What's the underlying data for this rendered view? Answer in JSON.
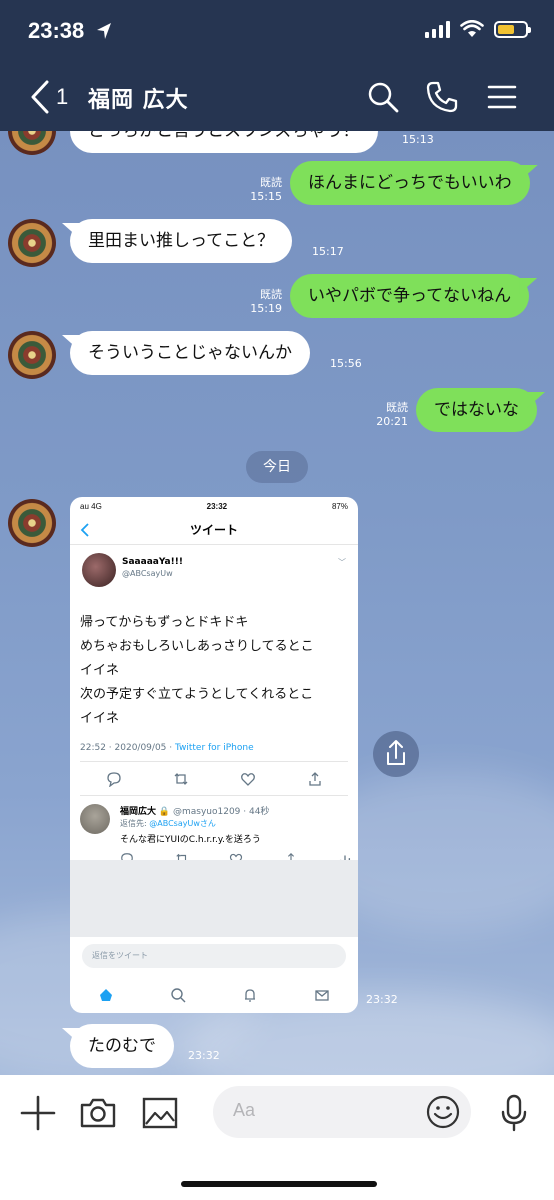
{
  "status_bar": {
    "time": "23:38"
  },
  "header": {
    "back_count": "1",
    "title": "福岡 広大"
  },
  "messages": [
    {
      "side": "left",
      "text": "どっちかと言うとスワンズちゃう？",
      "time": "15:13"
    },
    {
      "side": "right",
      "text": "ほんまにどっちでもいいわ",
      "read": "既読",
      "time": "15:15"
    },
    {
      "side": "left",
      "text": "里田まい推しってこと？",
      "time": "15:17"
    },
    {
      "side": "right",
      "text": "いやパボで争ってないねん",
      "read": "既読",
      "time": "15:19"
    },
    {
      "side": "left",
      "text": "そういうことじゃないんか",
      "time": "15:56"
    },
    {
      "side": "right",
      "text": "ではないな",
      "read": "既読",
      "time": "20:21"
    }
  ],
  "date_separator": "今日",
  "shared_image": {
    "time": "23:32",
    "status": {
      "carrier": "au  4G",
      "time": "23:32",
      "battery": "87%"
    },
    "header_title": "ツイート",
    "tweet": {
      "name": "SaaaaaYa!!!",
      "handle": "@ABCsayUw",
      "lines": [
        "帰ってからもずっとドキドキ",
        "めちゃおもしろいしあっさりしてるとこ",
        "イイネ",
        "次の予定すぐ立てようとしてくれるとこ",
        "イイネ"
      ],
      "timestamp": "22:52 · 2020/09/05 · ",
      "client": "Twitter for iPhone"
    },
    "reply": {
      "name": "福岡広大",
      "handle_time": "@masyuo1209 · 44秒",
      "to_prefix": "返信先: ",
      "to_handle": "@ABCsayUwさん",
      "text": "そんな君にYUIのC.h.r.r.y.を送ろう"
    },
    "reply_placeholder": "返信をツイート"
  },
  "last_message": {
    "side": "left",
    "text": "たのむで",
    "time": "23:32"
  },
  "input": {
    "placeholder": "Aa"
  },
  "icons": {
    "header": [
      "search-icon",
      "phone-icon",
      "menu-icon"
    ],
    "bottom": [
      "plus-icon",
      "camera-icon",
      "image-icon",
      "emoji-icon",
      "microphone-icon"
    ]
  },
  "colors": {
    "header_bg": "#263551",
    "own_bubble": "#7fe05a",
    "other_bubble": "#ffffff",
    "twitter_blue": "#1da1f2"
  }
}
